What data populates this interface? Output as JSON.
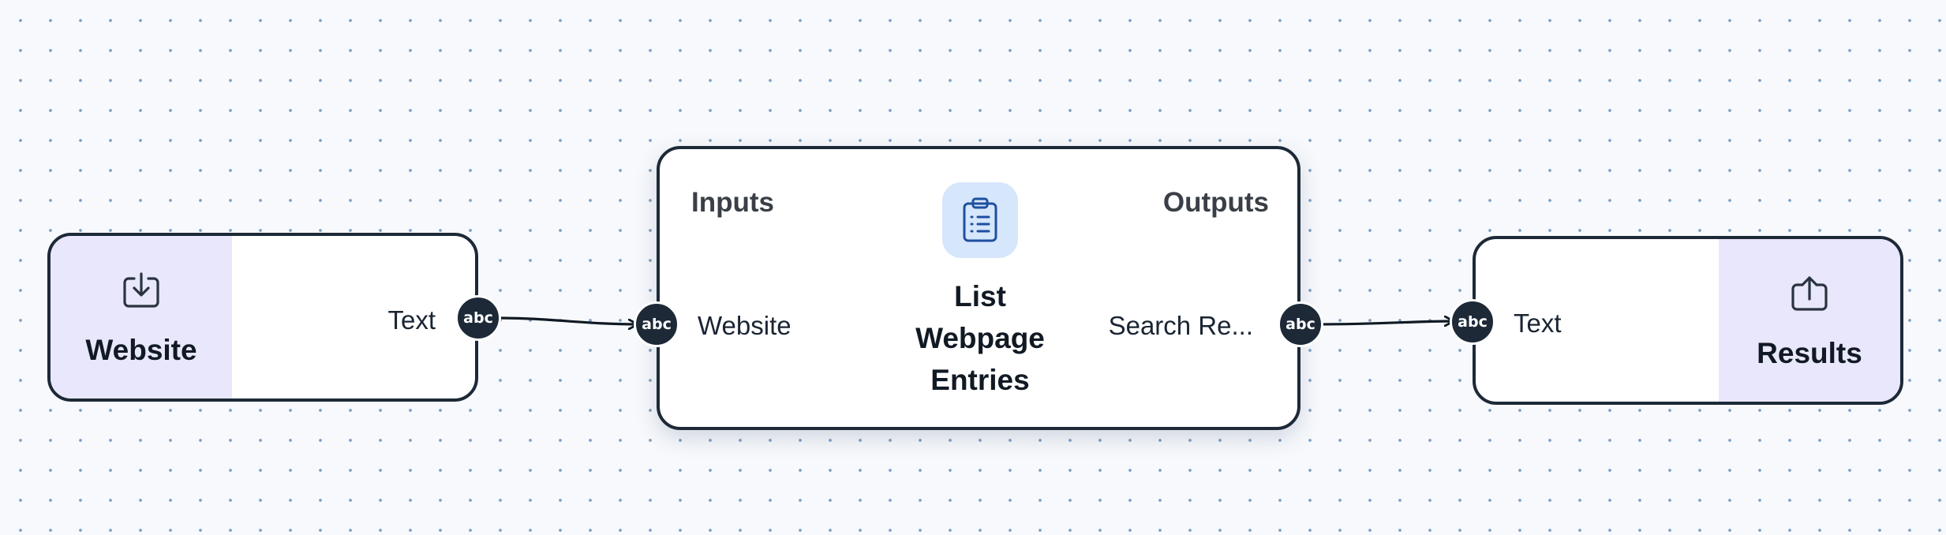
{
  "nodes": {
    "input": {
      "title": "Website",
      "icon": "download-tray-icon",
      "output_label": "Text",
      "port_type": "abc"
    },
    "main": {
      "inputs_heading": "Inputs",
      "outputs_heading": "Outputs",
      "icon": "clipboard-list-icon",
      "title_lines": [
        "List",
        "Webpage",
        "Entries"
      ],
      "input_port": {
        "label": "Website",
        "type": "abc"
      },
      "output_port": {
        "label": "Search Re...",
        "type": "abc"
      }
    },
    "output": {
      "title": "Results",
      "icon": "upload-tray-icon",
      "input_label": "Text",
      "port_type": "abc"
    }
  },
  "colors": {
    "node_border": "#1d2937",
    "io_panel": "#e9e7fb",
    "icon_tile": "#d6e6fb",
    "icon_stroke": "#1f4fa0",
    "canvas_dots": "#7f9fc4"
  }
}
